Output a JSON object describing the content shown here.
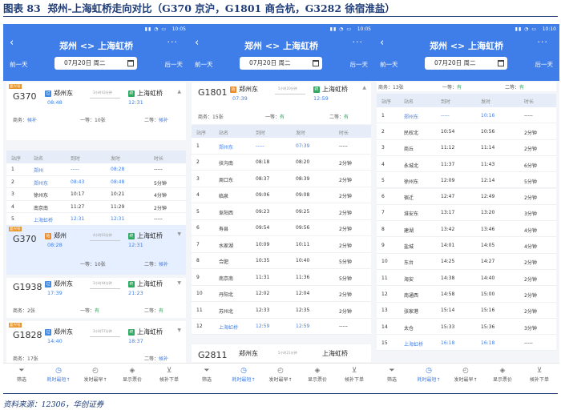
{
  "caption": {
    "label": "图表 83",
    "title": "郑州-上海虹桥走向对比（G370 京沪，G1801 商合杭，G3282 徐宿淮盐）"
  },
  "source": "资料来源：12306，华创证券",
  "statusbar": {
    "p1_time": "10:05",
    "p2_time": "10:05",
    "p3_time": "10:10"
  },
  "app": {
    "title": "郑州 <> 上海虹桥",
    "prev_day": "前一天",
    "next_day": "后一天",
    "date": "07月20日 周二"
  },
  "col_headers": [
    "站序",
    "站名",
    "到时",
    "发时",
    "时长"
  ],
  "seat_labels": {
    "business": "商务",
    "first": "一等",
    "second": "二等",
    "candidate": "候补"
  },
  "bottom_bar": [
    "筛选",
    "耗时最短↑",
    "发时最早↑",
    "显示票价",
    "候补下单"
  ],
  "p1": {
    "train1": {
      "tag": "复兴号",
      "no": "G370",
      "from": "郑州东",
      "from_icon": "过",
      "dep": "08:48",
      "dur": "3小时43分钟",
      "to": "上海虹桥",
      "to_icon": "终",
      "arr": "12:31",
      "biz": "候补",
      "first": "10张",
      "second": "候补"
    },
    "stops": [
      [
        "1",
        "郑州",
        "-----",
        "08:28",
        "-----"
      ],
      [
        "2",
        "郑州东",
        "08:43",
        "08:48",
        "5分钟"
      ],
      [
        "3",
        "徐州东",
        "10:17",
        "10:21",
        "4分钟"
      ],
      [
        "4",
        "南京南",
        "11:27",
        "11:29",
        "2分钟"
      ],
      [
        "5",
        "上海虹桥",
        "12:31",
        "12:31",
        "-----"
      ]
    ],
    "train2": {
      "tag": "复兴号",
      "no": "G370",
      "from": "郑州",
      "from_icon": "始",
      "dep": "08:28",
      "dur": "4小时03分钟",
      "to": "上海虹桥",
      "to_icon": "终",
      "arr": "12:31",
      "first": "10张",
      "second": "候补"
    },
    "train3": {
      "no": "G1938",
      "from": "郑州东",
      "from_icon": "过",
      "dep": "17:39",
      "dur": "3小时44分钟",
      "to": "上海虹桥",
      "to_icon": "终",
      "arr": "21:23",
      "biz": "2张",
      "first": "有",
      "second": "有"
    },
    "train4": {
      "tag": "复兴号",
      "no": "G1828",
      "from": "郑州东",
      "from_icon": "过",
      "dep": "14:40",
      "dur": "3小时57分钟",
      "to": "上海虹桥",
      "to_icon": "终",
      "arr": "18:37",
      "biz": "17张",
      "second": "候补"
    }
  },
  "p2": {
    "train1": {
      "no": "G1801",
      "from": "郑州东",
      "from_icon": "始",
      "dep": "07:39",
      "dur": "5小时20分钟",
      "to": "上海虹桥",
      "to_icon": "终",
      "arr": "12:59",
      "biz": "15张",
      "first": "有",
      "second": "有"
    },
    "stops": [
      [
        "1",
        "郑州东",
        "-----",
        "07:39",
        "-----"
      ],
      [
        "2",
        "扶沟南",
        "08:18",
        "08:20",
        "2分钟"
      ],
      [
        "3",
        "周口东",
        "08:37",
        "08:39",
        "2分钟"
      ],
      [
        "4",
        "临泉",
        "09:06",
        "09:08",
        "2分钟"
      ],
      [
        "5",
        "阜阳西",
        "09:23",
        "09:25",
        "2分钟"
      ],
      [
        "6",
        "寿县",
        "09:54",
        "09:56",
        "2分钟"
      ],
      [
        "7",
        "水家湖",
        "10:09",
        "10:11",
        "2分钟"
      ],
      [
        "8",
        "合肥",
        "10:35",
        "10:40",
        "5分钟"
      ],
      [
        "9",
        "南京南",
        "11:31",
        "11:36",
        "5分钟"
      ],
      [
        "10",
        "丹阳北",
        "12:02",
        "12:04",
        "2分钟"
      ],
      [
        "11",
        "苏州北",
        "12:33",
        "12:35",
        "2分钟"
      ],
      [
        "12",
        "上海虹桥",
        "12:59",
        "12:59",
        "-----"
      ]
    ],
    "train2": {
      "no": "G2811",
      "from": "郑州东",
      "dur": "5小时21分钟",
      "to": "上海虹桥"
    }
  },
  "p3": {
    "seats": {
      "biz": "13张",
      "first": "有",
      "second": "有"
    },
    "stops": [
      [
        "1",
        "郑州东",
        "-----",
        "10:16",
        "-----"
      ],
      [
        "2",
        "民权北",
        "10:54",
        "10:56",
        "2分钟"
      ],
      [
        "3",
        "商丘",
        "11:12",
        "11:14",
        "2分钟"
      ],
      [
        "4",
        "永城北",
        "11:37",
        "11:43",
        "6分钟"
      ],
      [
        "5",
        "徐州东",
        "12:09",
        "12:14",
        "5分钟"
      ],
      [
        "6",
        "宿迁",
        "12:47",
        "12:49",
        "2分钟"
      ],
      [
        "7",
        "淮安东",
        "13:17",
        "13:20",
        "3分钟"
      ],
      [
        "8",
        "建湖",
        "13:42",
        "13:46",
        "4分钟"
      ],
      [
        "9",
        "盐城",
        "14:01",
        "14:05",
        "4分钟"
      ],
      [
        "10",
        "东台",
        "14:25",
        "14:27",
        "2分钟"
      ],
      [
        "11",
        "海安",
        "14:38",
        "14:40",
        "2分钟"
      ],
      [
        "12",
        "南通西",
        "14:58",
        "15:00",
        "2分钟"
      ],
      [
        "13",
        "张家港",
        "15:14",
        "15:16",
        "2分钟"
      ],
      [
        "14",
        "太仓",
        "15:33",
        "15:36",
        "3分钟"
      ],
      [
        "15",
        "上海虹桥",
        "16:18",
        "16:18",
        "-----"
      ]
    ]
  }
}
